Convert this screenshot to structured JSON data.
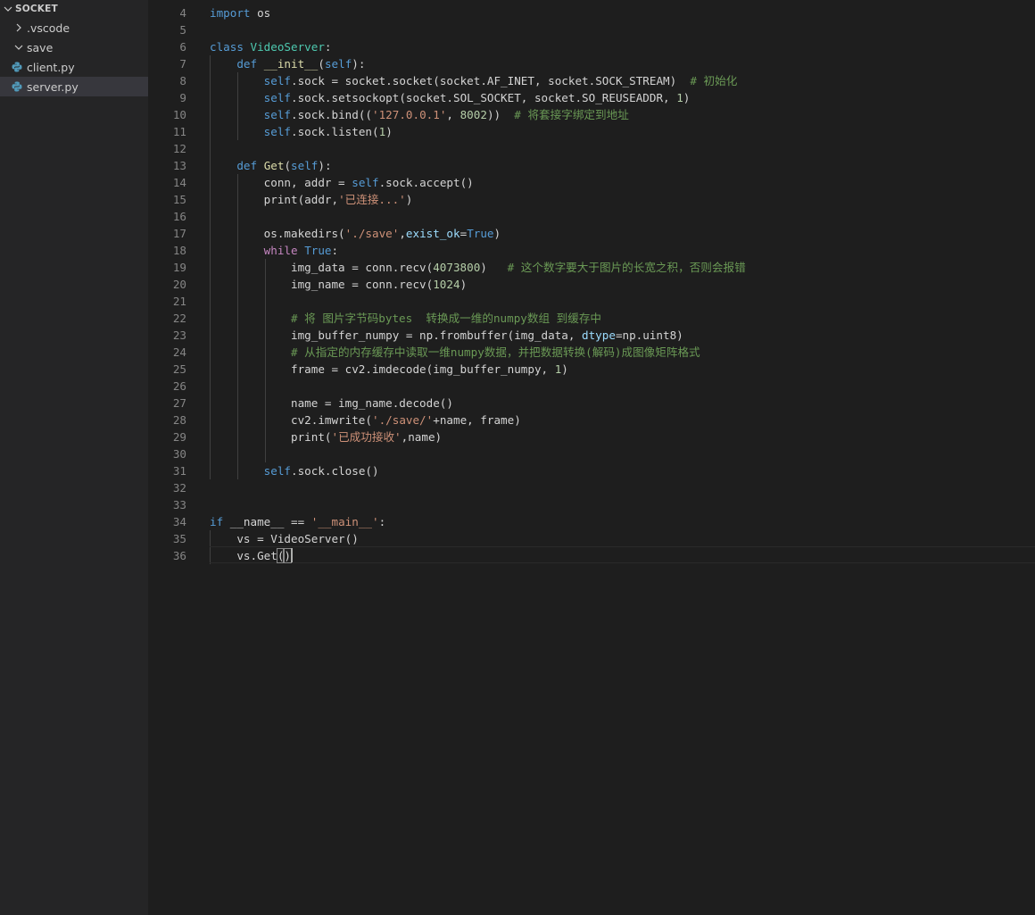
{
  "explorer": {
    "root_label": "SOCKET",
    "items": [
      {
        "label": ".vscode",
        "type": "folder",
        "expanded": false
      },
      {
        "label": "save",
        "type": "folder",
        "expanded": true
      },
      {
        "label": "client.py",
        "type": "python-file",
        "selected": false
      },
      {
        "label": "server.py",
        "type": "python-file",
        "selected": true
      }
    ]
  },
  "editor": {
    "language": "python",
    "first_visible_line": 4,
    "cursor": {
      "line": 36,
      "col": 13
    },
    "lines": [
      {
        "n": "4",
        "text": "import os"
      },
      {
        "n": "5",
        "text": ""
      },
      {
        "n": "6",
        "text": "class VideoServer:"
      },
      {
        "n": "7",
        "text": "    def __init__(self):"
      },
      {
        "n": "8",
        "text": "        self.sock = socket.socket(socket.AF_INET, socket.SOCK_STREAM)  # 初始化"
      },
      {
        "n": "9",
        "text": "        self.sock.setsockopt(socket.SOL_SOCKET, socket.SO_REUSEADDR, 1)"
      },
      {
        "n": "10",
        "text": "        self.sock.bind(('127.0.0.1', 8002))  # 将套接字绑定到地址"
      },
      {
        "n": "11",
        "text": "        self.sock.listen(1)"
      },
      {
        "n": "12",
        "text": ""
      },
      {
        "n": "13",
        "text": "    def Get(self):"
      },
      {
        "n": "14",
        "text": "        conn, addr = self.sock.accept()"
      },
      {
        "n": "15",
        "text": "        print(addr,'已连接...')"
      },
      {
        "n": "16",
        "text": ""
      },
      {
        "n": "17",
        "text": "        os.makedirs('./save',exist_ok=True)"
      },
      {
        "n": "18",
        "text": "        while True:"
      },
      {
        "n": "19",
        "text": "            img_data = conn.recv(4073800)   # 这个数字要大于图片的长宽之积，否则会报错"
      },
      {
        "n": "20",
        "text": "            img_name = conn.recv(1024)"
      },
      {
        "n": "21",
        "text": ""
      },
      {
        "n": "22",
        "text": "            # 将 图片字节码bytes  转换成一维的numpy数组 到缓存中"
      },
      {
        "n": "23",
        "text": "            img_buffer_numpy = np.frombuffer(img_data, dtype=np.uint8)"
      },
      {
        "n": "24",
        "text": "            # 从指定的内存缓存中读取一维numpy数据，并把数据转换(解码)成图像矩阵格式"
      },
      {
        "n": "25",
        "text": "            frame = cv2.imdecode(img_buffer_numpy, 1)"
      },
      {
        "n": "26",
        "text": ""
      },
      {
        "n": "27",
        "text": "            name = img_name.decode()"
      },
      {
        "n": "28",
        "text": "            cv2.imwrite('./save/'+name, frame)"
      },
      {
        "n": "29",
        "text": "            print('已成功接收',name)"
      },
      {
        "n": "30",
        "text": ""
      },
      {
        "n": "31",
        "text": "        self.sock.close()"
      },
      {
        "n": "32",
        "text": ""
      },
      {
        "n": "33",
        "text": ""
      },
      {
        "n": "34",
        "text": "if __name__ == '__main__':"
      },
      {
        "n": "35",
        "text": "    vs = VideoServer()"
      },
      {
        "n": "36",
        "text": "    vs.Get()"
      }
    ]
  },
  "colors": {
    "editor_bg": "#1e1e1e",
    "sidebar_bg": "#252526",
    "keyword": "#569cd6",
    "control_keyword": "#c586c0",
    "class_name": "#4ec9b0",
    "function": "#dcdcaa",
    "string": "#ce9178",
    "number": "#b5cea8",
    "comment": "#6a9955",
    "parameter": "#9cdcfe"
  }
}
